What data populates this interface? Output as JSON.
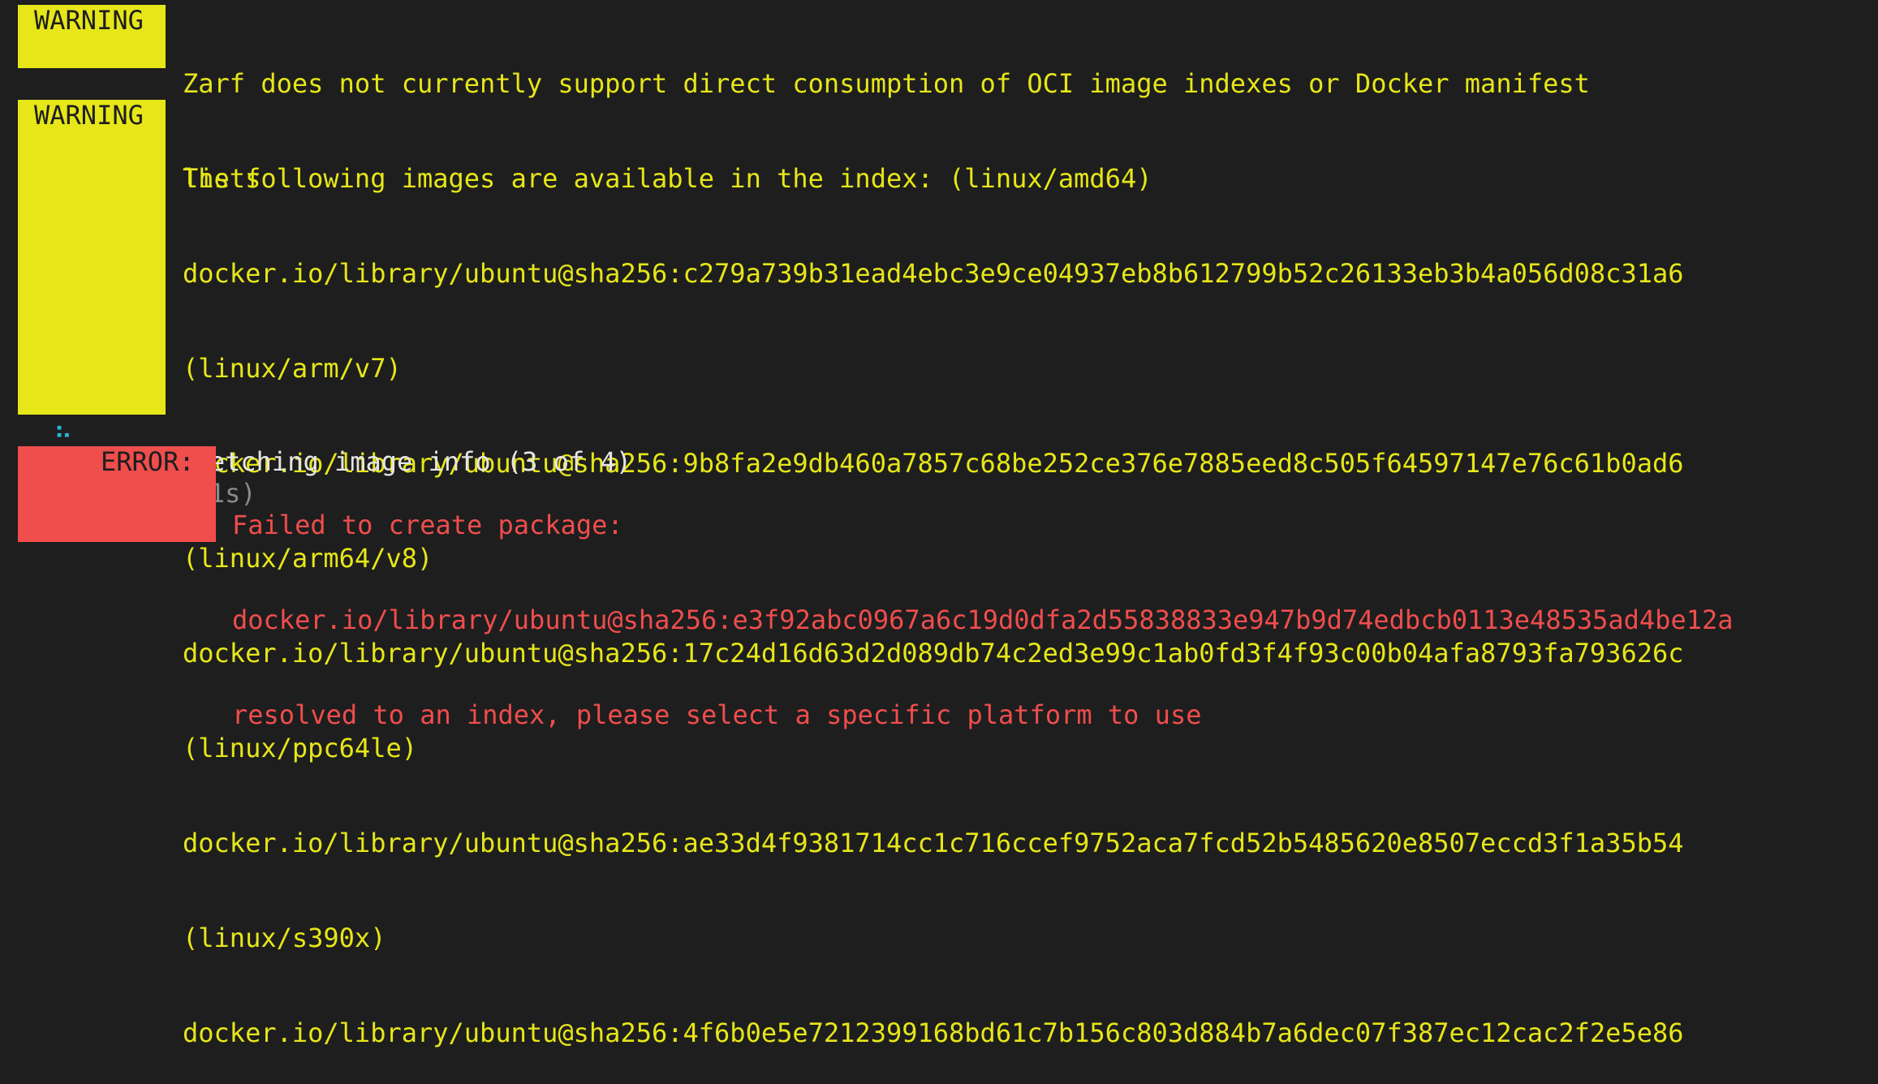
{
  "warnings": [
    {
      "badge": "WARNING",
      "lines": [
        "Zarf does not currently support direct consumption of OCI image indexes or Docker manifest",
        "lists"
      ]
    },
    {
      "badge": "WARNING",
      "lines": [
        "The following images are available in the index: (linux/amd64)",
        "docker.io/library/ubuntu@sha256:c279a739b31ead4ebc3e9ce04937eb8b612799b52c26133eb3b4a056d08c31a6",
        "(linux/arm/v7)",
        "docker.io/library/ubuntu@sha256:9b8fa2e9db460a7857c68be252ce376e7885eed8c505f64597147e76c61b0ad6",
        "(linux/arm64/v8)",
        "docker.io/library/ubuntu@sha256:17c24d16d63d2d089db74c2ed3e99c1ab0fd3f4f93c00b04afa8793fa793626c",
        "(linux/ppc64le)",
        "docker.io/library/ubuntu@sha256:ae33d4f9381714cc1c716ccef9752aca7fcd52b5485620e8507eccd3f1a35b54",
        "(linux/s390x)",
        "docker.io/library/ubuntu@sha256:4f6b0e5e7212399168bd61c7b156c803d884b7a6dec07f387ec12cac2f2e5e86"
      ]
    }
  ],
  "progress": {
    "spinner": "⠦",
    "text": "Fetching image info (3 of 4)",
    "elapsed": "(1s)"
  },
  "error": {
    "badge": "ERROR:",
    "lines": [
      "Failed to create package:",
      "docker.io/library/ubuntu@sha256:e3f92abc0967a6c19d0dfa2d55838833e947b9d74edbcb0113e48535ad4be12a",
      "resolved to an index, please select a specific platform to use"
    ]
  },
  "colors": {
    "background": "#1e1e1e",
    "warning": "#e6e619",
    "error": "#f04d4d",
    "spinner": "#29b8db",
    "text": "#e5e5e5",
    "muted": "#8a8a8a"
  }
}
